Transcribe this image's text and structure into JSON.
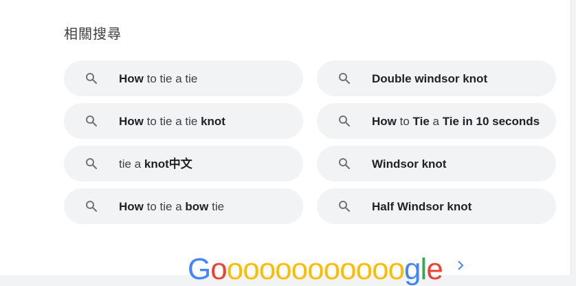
{
  "heading": "相關搜尋",
  "related": [
    {
      "parts": [
        {
          "t": "How",
          "b": true
        },
        {
          "t": " to tie a tie",
          "b": false
        }
      ]
    },
    {
      "parts": [
        {
          "t": "Double windsor knot",
          "b": true
        }
      ]
    },
    {
      "parts": [
        {
          "t": "How",
          "b": true
        },
        {
          "t": " to tie a tie ",
          "b": false
        },
        {
          "t": "knot",
          "b": true
        }
      ]
    },
    {
      "parts": [
        {
          "t": "How",
          "b": true
        },
        {
          "t": " to ",
          "b": false
        },
        {
          "t": "Tie",
          "b": true
        },
        {
          "t": " a ",
          "b": false
        },
        {
          "t": "Tie in 10 seconds",
          "b": true
        }
      ]
    },
    {
      "parts": [
        {
          "t": "tie a ",
          "b": false
        },
        {
          "t": "knot中文",
          "b": true
        }
      ]
    },
    {
      "parts": [
        {
          "t": "Windsor knot",
          "b": true
        }
      ]
    },
    {
      "parts": [
        {
          "t": "How",
          "b": true
        },
        {
          "t": " to tie a ",
          "b": false
        },
        {
          "t": "bow",
          "b": true
        },
        {
          "t": " tie",
          "b": false
        }
      ]
    },
    {
      "parts": [
        {
          "t": "Half Windsor knot",
          "b": true
        }
      ]
    }
  ],
  "pagination": {
    "logo_text": "Goooooooooooogle",
    "letter_colors": [
      "blue",
      "red",
      "yellow",
      "yellow",
      "yellow",
      "yellow",
      "yellow",
      "yellow",
      "yellow",
      "yellow",
      "yellow",
      "yellow",
      "yellow",
      "blue",
      "green",
      "red"
    ],
    "next_icon": "chevron-right-icon"
  },
  "colors": {
    "blue": "#4285f4",
    "red": "#ea4335",
    "yellow": "#fbbc05",
    "green": "#34a853",
    "chip_bg": "#f1f3f4",
    "icon": "#70757a"
  }
}
